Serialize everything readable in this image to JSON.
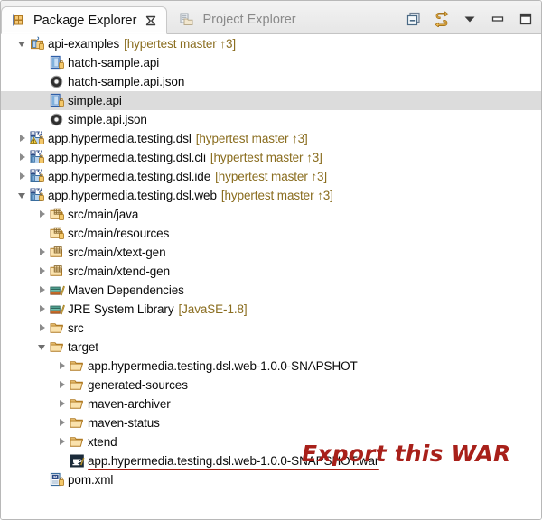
{
  "window": {
    "title": "Package Explorer"
  },
  "tabs": [
    {
      "label": "Package Explorer",
      "icon": "package-explorer-icon",
      "active": true,
      "closable": true
    },
    {
      "label": "Project Explorer",
      "icon": "project-explorer-icon",
      "active": false,
      "closable": false
    }
  ],
  "toolbar": [
    {
      "name": "collapse-all-button",
      "tooltip": "Collapse All"
    },
    {
      "name": "link-with-editor-button",
      "tooltip": "Link with Editor"
    },
    {
      "name": "view-menu-button",
      "tooltip": "View Menu"
    },
    {
      "name": "minimize-button",
      "tooltip": "Minimize"
    },
    {
      "name": "maximize-button",
      "tooltip": "Maximize"
    }
  ],
  "colors": {
    "annotation": "#a8201a",
    "repo_meta": "#8a6d1f",
    "selection": "#dcdcdc",
    "folder": "#f6d188"
  },
  "annotation": {
    "text": "Export this WAR"
  },
  "tree": [
    {
      "label": "api-examples",
      "meta": "[hypertest master ↑3]",
      "icon": "project-icon",
      "indent": 0,
      "twisty": "expanded",
      "selected": false
    },
    {
      "label": "hatch-sample.api",
      "meta": "",
      "icon": "api-file-icon",
      "indent": 1,
      "twisty": "none",
      "selected": false
    },
    {
      "label": "hatch-sample.api.json",
      "meta": "",
      "icon": "json-file-icon",
      "indent": 1,
      "twisty": "none",
      "selected": false
    },
    {
      "label": "simple.api",
      "meta": "",
      "icon": "api-file-icon",
      "indent": 1,
      "twisty": "none",
      "selected": true
    },
    {
      "label": "simple.api.json",
      "meta": "",
      "icon": "json-file-icon",
      "indent": 1,
      "twisty": "none",
      "selected": false
    },
    {
      "label": "app.hypermedia.testing.dsl",
      "meta": "[hypertest master ↑3]",
      "icon": "maven-project-warning-icon",
      "indent": 0,
      "twisty": "collapsed",
      "selected": false
    },
    {
      "label": "app.hypermedia.testing.dsl.cli",
      "meta": "[hypertest master ↑3]",
      "icon": "maven-project-icon",
      "indent": 0,
      "twisty": "collapsed",
      "selected": false
    },
    {
      "label": "app.hypermedia.testing.dsl.ide",
      "meta": "[hypertest master ↑3]",
      "icon": "maven-project-icon",
      "indent": 0,
      "twisty": "collapsed",
      "selected": false
    },
    {
      "label": "app.hypermedia.testing.dsl.web",
      "meta": "[hypertest master ↑3]",
      "icon": "maven-project-icon",
      "indent": 0,
      "twisty": "expanded",
      "selected": false
    },
    {
      "label": "src/main/java",
      "meta": "",
      "icon": "source-folder-icon",
      "indent": 1,
      "twisty": "collapsed",
      "selected": false
    },
    {
      "label": "src/main/resources",
      "meta": "",
      "icon": "source-folder-icon",
      "indent": 1,
      "twisty": "none",
      "selected": false
    },
    {
      "label": "src/main/xtext-gen",
      "meta": "",
      "icon": "source-folder-plain-icon",
      "indent": 1,
      "twisty": "collapsed",
      "selected": false
    },
    {
      "label": "src/main/xtend-gen",
      "meta": "",
      "icon": "source-folder-plain-icon",
      "indent": 1,
      "twisty": "collapsed",
      "selected": false
    },
    {
      "label": "Maven Dependencies",
      "meta": "",
      "icon": "library-icon",
      "indent": 1,
      "twisty": "collapsed",
      "selected": false
    },
    {
      "label": "JRE System Library",
      "meta": "[JavaSE-1.8]",
      "icon": "library-icon",
      "indent": 1,
      "twisty": "collapsed",
      "selected": false
    },
    {
      "label": "src",
      "meta": "",
      "icon": "folder-icon",
      "indent": 1,
      "twisty": "collapsed",
      "selected": false
    },
    {
      "label": "target",
      "meta": "",
      "icon": "folder-icon",
      "indent": 1,
      "twisty": "expanded",
      "selected": false
    },
    {
      "label": "app.hypermedia.testing.dsl.web-1.0.0-SNAPSHOT",
      "meta": "",
      "icon": "folder-icon",
      "indent": 2,
      "twisty": "collapsed",
      "selected": false
    },
    {
      "label": "generated-sources",
      "meta": "",
      "icon": "folder-icon",
      "indent": 2,
      "twisty": "collapsed",
      "selected": false
    },
    {
      "label": "maven-archiver",
      "meta": "",
      "icon": "folder-icon",
      "indent": 2,
      "twisty": "collapsed",
      "selected": false
    },
    {
      "label": "maven-status",
      "meta": "",
      "icon": "folder-icon",
      "indent": 2,
      "twisty": "collapsed",
      "selected": false
    },
    {
      "label": "xtend",
      "meta": "",
      "icon": "folder-icon",
      "indent": 2,
      "twisty": "collapsed",
      "selected": false
    },
    {
      "label": "app.hypermedia.testing.dsl.web-1.0.0-SNAPSHOT.war",
      "meta": "",
      "icon": "war-file-icon",
      "indent": 2,
      "twisty": "none",
      "selected": false,
      "underline": true
    },
    {
      "label": "pom.xml",
      "meta": "",
      "icon": "xml-file-icon",
      "indent": 1,
      "twisty": "none",
      "selected": false
    }
  ]
}
